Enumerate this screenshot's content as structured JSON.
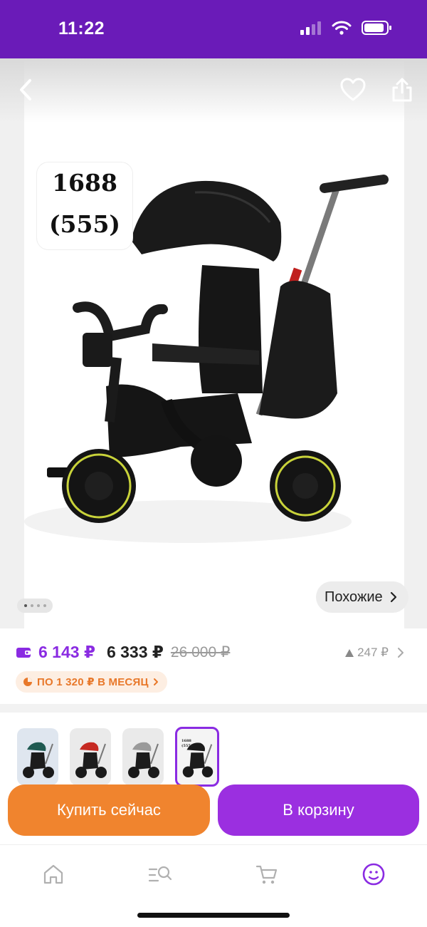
{
  "status_bar": {
    "time": "11:22"
  },
  "product": {
    "image_label_line1": "1688",
    "image_label_line2": "(555)"
  },
  "gallery": {
    "total_dots": 4,
    "active_dot": 1,
    "similar_label": "Похожие"
  },
  "price": {
    "card_price": "6 143 ₽",
    "regular_price": "6 333 ₽",
    "old_price": "26 000 ₽",
    "price_change": "247 ₽",
    "installment": "ПО 1 320 ₽ В МЕСЯЦ"
  },
  "variants": {
    "items": [
      {
        "color": "green"
      },
      {
        "color": "red"
      },
      {
        "color": "grey"
      },
      {
        "color": "black",
        "selected": true,
        "mini_label_line1": "1688",
        "mini_label_line2": "(555)"
      }
    ]
  },
  "actions": {
    "buy_now": "Купить сейчас",
    "add_to_cart": "В корзину"
  },
  "bottom_nav": {
    "tabs": [
      "home-icon",
      "catalog-search-icon",
      "cart-icon",
      "profile-icon"
    ],
    "active_tab": "profile-icon"
  },
  "colors": {
    "brand_purple": "#6a1bb8",
    "accent_purple": "#8a2be2",
    "buy_orange": "#f0842e",
    "cart_purple": "#9b2fe0"
  }
}
